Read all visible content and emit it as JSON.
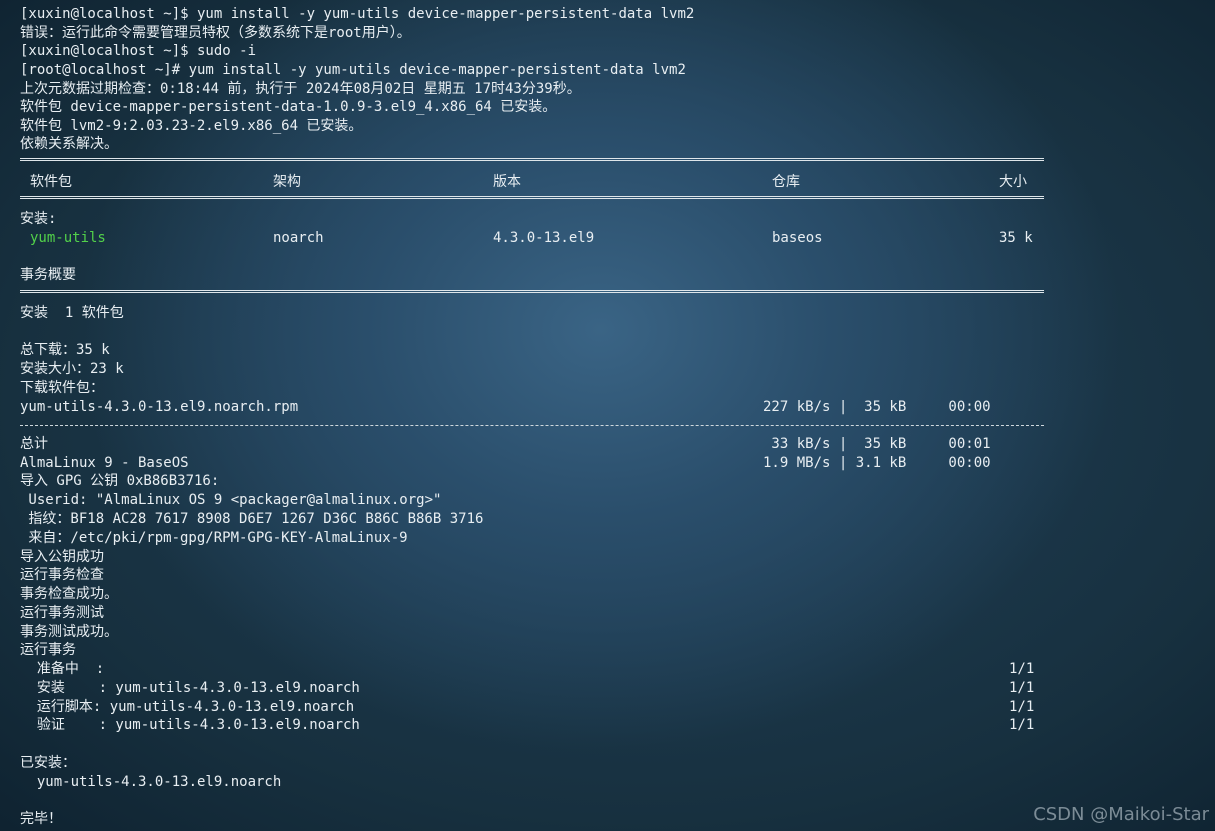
{
  "lines": {
    "l1": "[xuxin@localhost ~]$ yum install -y yum-utils device-mapper-persistent-data lvm2",
    "l2": "错误：运行此命令需要管理员特权（多数系统下是root用户）。",
    "l3": "[xuxin@localhost ~]$ sudo -i",
    "l4": "[root@localhost ~]# yum install -y yum-utils device-mapper-persistent-data lvm2",
    "l5": "上次元数据过期检查：0:18:44 前，执行于 2024年08月02日 星期五 17时43分39秒。",
    "l6": "软件包 device-mapper-persistent-data-1.0.9-3.el9_4.x86_64 已安装。",
    "l7": "软件包 lvm2-9:2.03.23-2.el9.x86_64 已安装。",
    "l8": "依赖关系解决。"
  },
  "table": {
    "headers": {
      "package": "软件包",
      "arch": "架构",
      "version": "版本",
      "repo": "仓库",
      "size": "大小"
    },
    "install_label": "安装:",
    "row": {
      "package": "yum-utils",
      "arch": "noarch",
      "version": "4.3.0-13.el9",
      "repo": "baseos",
      "size": "35 k"
    },
    "summary_label": "事务概要",
    "summary": "安装  1 软件包"
  },
  "download": {
    "total_download": "总下载：35 k",
    "install_size": "安装大小：23 k",
    "downloading": "下载软件包：",
    "rpm": {
      "name": "yum-utils-4.3.0-13.el9.noarch.rpm",
      "stats": "227 kB/s |  35 kB     00:00"
    },
    "total": {
      "name": "总计",
      "stats": " 33 kB/s |  35 kB     00:01"
    },
    "baseos": {
      "name": "AlmaLinux 9 - BaseOS",
      "stats": "1.9 MB/s | 3.1 kB     00:00"
    }
  },
  "gpg": {
    "import": "导入 GPG 公钥 0xB86B3716:",
    "userid": " Userid: \"AlmaLinux OS 9 <packager@almalinux.org>\"",
    "fingerprint": " 指纹：BF18 AC28 7617 8908 D6E7 1267 D36C B86C B86B 3716",
    "source": " 来自：/etc/pki/rpm-gpg/RPM-GPG-KEY-AlmaLinux-9",
    "success": "导入公钥成功"
  },
  "transaction": {
    "check": "运行事务检查",
    "check_ok": "事务检查成功。",
    "test": "运行事务测试",
    "test_ok": "事务测试成功。",
    "run": "运行事务",
    "steps": [
      {
        "label": "  准备中  :",
        "count": "1/1"
      },
      {
        "label": "  安装    : yum-utils-4.3.0-13.el9.noarch",
        "count": "1/1"
      },
      {
        "label": "  运行脚本: yum-utils-4.3.0-13.el9.noarch",
        "count": "1/1"
      },
      {
        "label": "  验证    : yum-utils-4.3.0-13.el9.noarch",
        "count": "1/1"
      }
    ],
    "installed_label": "已安装：",
    "installed_pkg": "  yum-utils-4.3.0-13.el9.noarch",
    "done": "完毕！"
  },
  "watermark": "CSDN @Maikoi-Star"
}
